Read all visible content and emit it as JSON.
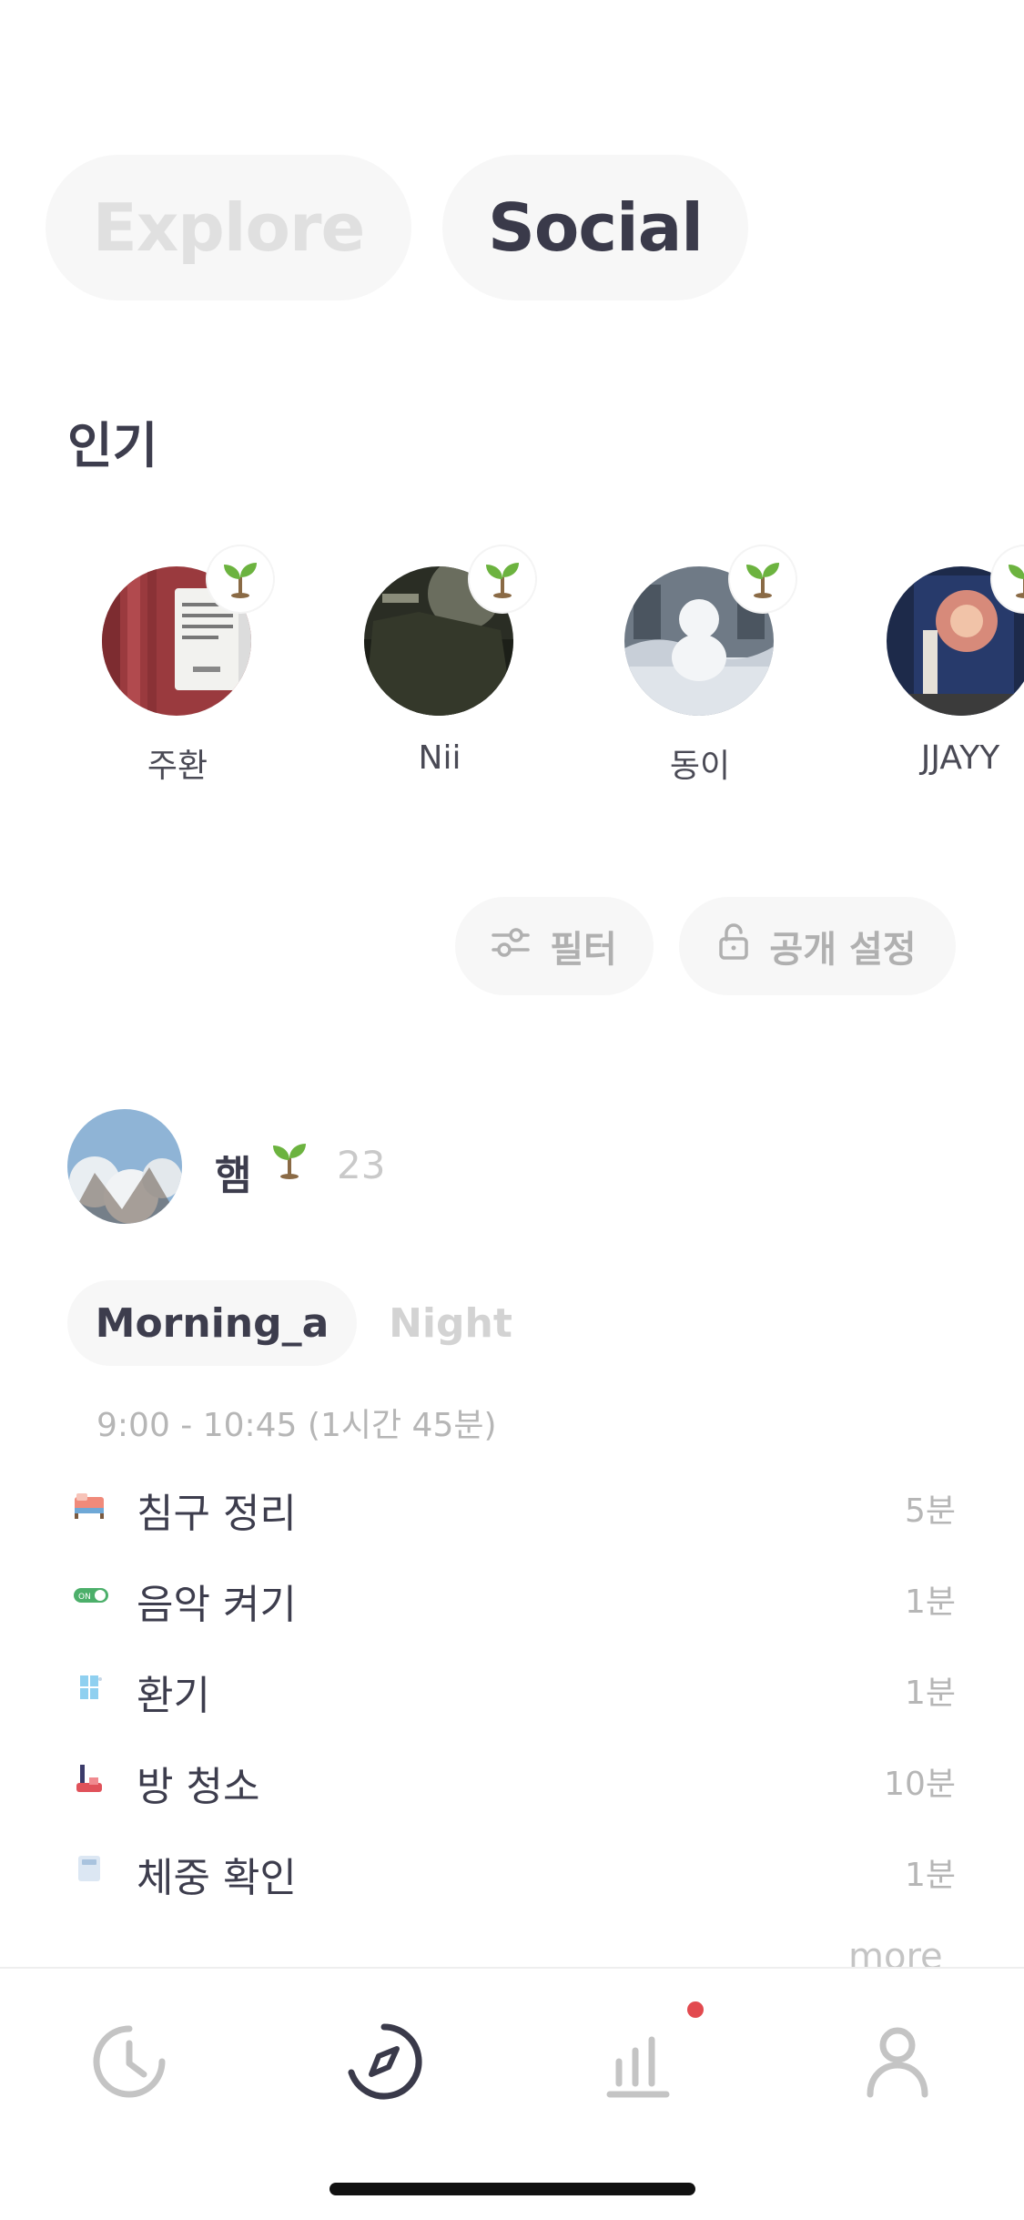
{
  "top_tabs": [
    {
      "label": "Explore",
      "active": false
    },
    {
      "label": "Social",
      "active": true
    }
  ],
  "popular": {
    "title": "인기",
    "users": [
      {
        "name": "주환",
        "badge_icon": "sprout-icon"
      },
      {
        "name": "Nii",
        "badge_icon": "sprout-icon"
      },
      {
        "name": "동이",
        "badge_icon": "sprout-icon"
      },
      {
        "name": "JJAYY",
        "badge_icon": "sprout-icon"
      }
    ]
  },
  "actions": {
    "filter_label": "필터",
    "privacy_label": "공개 설정"
  },
  "post": {
    "user_name": "햄",
    "count": "23",
    "routine_tabs": [
      {
        "label": "Morning_a",
        "active": true
      },
      {
        "label": "Night",
        "active": false
      }
    ],
    "time_range": "9:00 - 10:45 (1시간 45분)",
    "tasks": [
      {
        "icon": "bed-icon",
        "label": "침구 정리",
        "duration": "5분"
      },
      {
        "icon": "toggle-on-icon",
        "label": "음악 켜기",
        "duration": "1분"
      },
      {
        "icon": "window-icon",
        "label": "환기",
        "duration": "1분"
      },
      {
        "icon": "vacuum-icon",
        "label": "방 청소",
        "duration": "10분"
      },
      {
        "icon": "scale-icon",
        "label": "체중 확인",
        "duration": "1분"
      }
    ],
    "more_label": "more"
  },
  "bottom_nav": [
    {
      "icon": "clock-icon",
      "active": false
    },
    {
      "icon": "compass-icon",
      "active": true
    },
    {
      "icon": "chart-icon",
      "active": false,
      "has_notification": true
    },
    {
      "icon": "profile-icon",
      "active": false
    }
  ],
  "colors": {
    "accent_text": "#3a3a4a",
    "muted": "#b6b6b6",
    "notification": "#e24a4f",
    "sprout": "#6cb33f"
  }
}
